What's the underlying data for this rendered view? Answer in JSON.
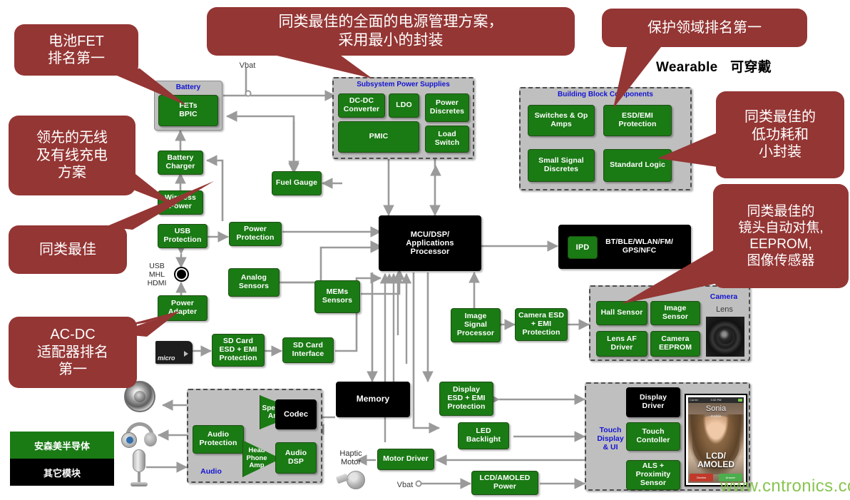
{
  "meta": {
    "header_en": "Wearable",
    "header_zh": "可穿戴",
    "watermark": "www.cntronics.com"
  },
  "legend": {
    "onsemi": "安森美半导体",
    "other": "其它模块"
  },
  "callouts": [
    {
      "id": "battery-fet",
      "text": "电池FET\n排名第一"
    },
    {
      "id": "charging",
      "text": "领先的无线\n及有线充电\n方案"
    },
    {
      "id": "best-in-class",
      "text": "同类最佳"
    },
    {
      "id": "acdc",
      "text": "AC-DC\n适配器排名\n第一"
    },
    {
      "id": "power-mgmt",
      "text": "同类最佳的全面的电源管理方案，\n采用最小的封装"
    },
    {
      "id": "protection",
      "text": "保护领域排名第一"
    },
    {
      "id": "low-power",
      "text": "同类最佳的\n低功耗和\n小封装"
    },
    {
      "id": "camera",
      "text": "同类最佳的\n镜头自动对焦,\nEEPROM,\n图像传感器"
    }
  ],
  "groups": {
    "battery": {
      "title": "Battery"
    },
    "subsystem": {
      "title": "Subsystem Power Supplies"
    },
    "building": {
      "title": "Building Block Components"
    },
    "camera": {
      "title": "Camera"
    },
    "audio": {
      "title": "Audio"
    },
    "touch": {
      "title": "Touch\nDisplay\n& UI"
    }
  },
  "blocks": {
    "fets_bpic": "FETs\nBPIC",
    "battery_charger": "Battery\nCharger",
    "wireless_power": "Wireless\nPower",
    "usb_protection": "USB\nProtection",
    "power_adapter": "Power\nAdapter",
    "fuel_gauge": "Fuel Gauge",
    "power_protection": "Power\nProtection",
    "analog_sensors": "Analog\nSensors",
    "mems_sensors": "MEMs\nSensors",
    "sd_esd": "SD Card\nESD + EMI\nProtection",
    "sd_interface": "SD Card\nInterface",
    "dcdc": "DC-DC\nConverter",
    "ldo": "LDO",
    "power_discretes": "Power\nDiscretes",
    "pmic": "PMIC",
    "load_switch": "Load\nSwitch",
    "mcu": "MCU/DSP/\nApplications\nProcessor",
    "ipd": "IPD",
    "radio": "BT/BLE/WLAN/FM/\nGPS/NFC",
    "switches_opamps": "Switches & Op\nAmps",
    "esd_emi": "ESD/EMI\nProtection",
    "small_signal": "Small Signal\nDiscretes",
    "standard_logic": "Standard Logic",
    "hall_sensor": "Hall Sensor",
    "image_sensor": "Image Sensor",
    "lens_af": "Lens AF\nDriver",
    "camera_eeprom": "Camera\nEEPROM",
    "image_signal_proc": "Image\nSignal\nProcessor",
    "camera_esd": "Camera ESD\n+ EMI\nProtection",
    "memory": "Memory",
    "display_esd": "Display\nESD + EMI\nProtection",
    "led_backlight": "LED\nBacklight",
    "motor_driver": "Motor Driver",
    "lcd_power": "LCD/AMOLED\nPower",
    "display_driver": "Display\nDriver",
    "touch_controller": "Touch\nContoller",
    "als_proximity": "ALS +\nProximity\nSensor",
    "speaker_amp": "Speaker\nAmp",
    "codec": "Codec",
    "audio_protection": "Audio\nProtection",
    "headphone_amp": "Head\nPhone\nAmp",
    "audio_dsp": "Audio DSP"
  },
  "labels": {
    "vbat_top": "Vbat",
    "vbat_bottom": "Vbat",
    "usb_mhl_hdmi": "USB\nMHL\nHDMI",
    "haptic_motor": "Haptic\nMotor",
    "lens": "Lens"
  },
  "phone": {
    "status_left": "Carrier",
    "status_time": "3:32 PM",
    "caller": "Sonia",
    "caller_sub": "mobile",
    "screen_label": "LCD/\nAMOLED",
    "decline": "Decline",
    "answer": "Answer"
  },
  "colors": {
    "onsemi_green": "#1a7a14",
    "other_black": "#000000",
    "callout_red": "#943634",
    "group_grey": "#bfbfbf",
    "label_blue": "#1414d2",
    "wire_grey": "#9a9a9a",
    "watermark_green": "#7ec142"
  }
}
